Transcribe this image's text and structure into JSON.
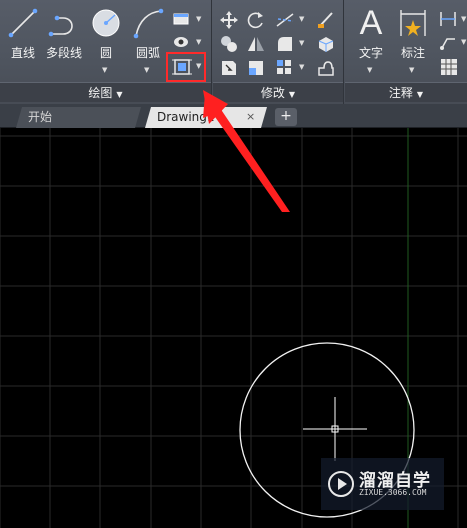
{
  "ribbon": {
    "draw_panel": {
      "title": "绘图",
      "line_label": "直线",
      "polyline_label": "多段线",
      "circle_label": "圆",
      "arc_label": "圆弧"
    },
    "modify_panel": {
      "title": "修改"
    },
    "annotation_panel": {
      "title": "注释",
      "text_label": "文字",
      "text_glyph": "A",
      "dimension_label": "标注"
    },
    "highlight_color": "#ff2a2a"
  },
  "tabs": {
    "start_label": "开始",
    "drawing_label": "Drawing1",
    "close_glyph": "×",
    "add_glyph": "+"
  },
  "watermark": {
    "name": "溜溜自学",
    "url": "ZIXUE.3066.COM"
  },
  "colors": {
    "canvas_bg": "#000000",
    "grid_line": "#2a2a2a",
    "y_axis": "#1f5a1f",
    "annotation_arrow": "#ff2020"
  }
}
